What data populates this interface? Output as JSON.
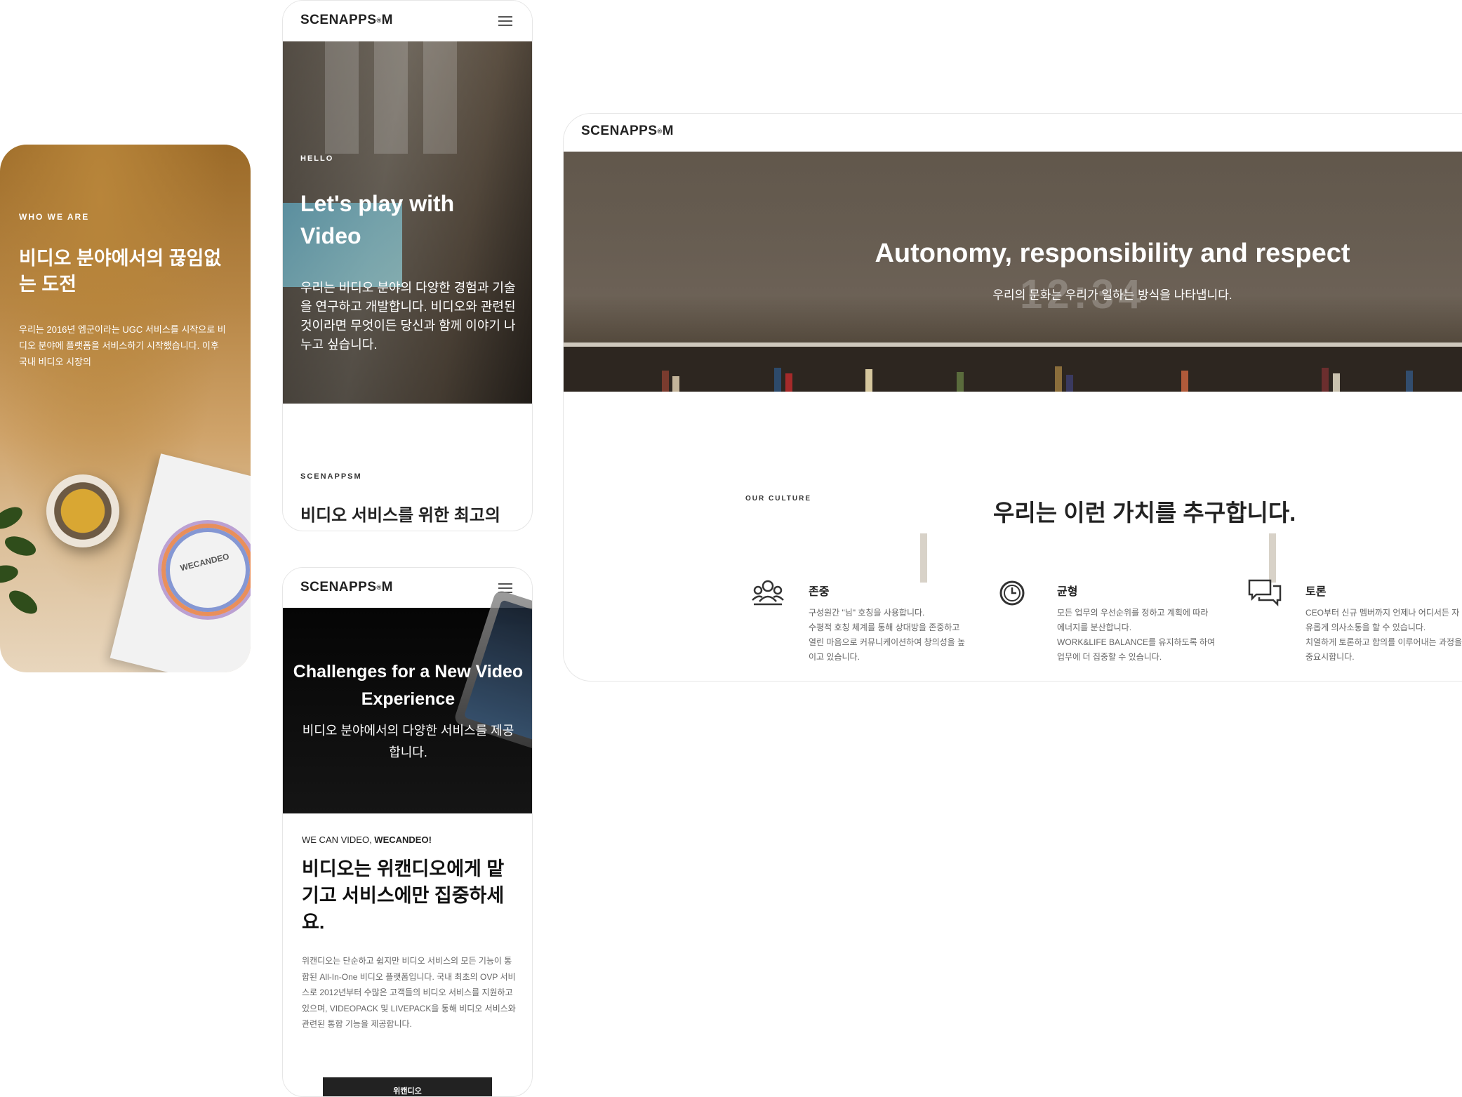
{
  "who_card": {
    "eyebrow": "WHO WE ARE",
    "title": "비디오 분야에서의 끊임없는 도전",
    "body": "우리는 2016년 엠군이라는 UGC 서비스를 시작으로 비디오 분야에 플랫폼을 서비스하기 시작했습니다. 이후 국내 비디오 시장의",
    "product_label": "WECANDEO"
  },
  "hello_card": {
    "logo": "SCENAPPS",
    "logo_dot": "®",
    "logo_suffix": "M",
    "eyebrow": "HELLO",
    "title": "Let's play with Video",
    "desc": "우리는 비디오 분야의 다양한 경험과 기술을 연구하고 개발합니다. 비디오와 관련된 것이라면 무엇이든 당신과 함께 이야기 나누고 싶습니다.",
    "section_label": "SCENAPPSM",
    "section_title": "비디오 서비스를 위한 최고의"
  },
  "challenge_card": {
    "logo": "SCENAPPS",
    "logo_dot": "®",
    "logo_suffix": "M",
    "title": "Challenges for a New Video Experience",
    "desc": "비디오 분야에서의 다양한 서비스를 제공합니다.",
    "kicker_plain": "WE CAN VIDEO, ",
    "kicker_bold": "WECANDEO!",
    "headline": "비디오는 위캔디오에게 맡기고 서비스에만 집중하세요.",
    "body": "위캔디오는 단순하고 쉽지만 비디오 서비스의 모든 기능이 통합된 All-In-One 비디오 플랫폼입니다. 국내 최초의 OVP 서비스로 2012년부터 수많은 고객들의 비디오 서비스를 지원하고 있으며, VIDEOPACK 및 LIVEPACK을 통해 비디오 서비스와 관련된 통합 기능을 제공합니다.",
    "cta": "위캔디오"
  },
  "culture_page": {
    "logo": "SCENAPPS",
    "logo_dot": "®",
    "logo_suffix": "M",
    "hero_title": "Autonomy, responsibility and respect",
    "hero_subtitle": "우리의 문화는 우리가 일하는 방식을 나타냅니다.",
    "clock_text": "12:34",
    "section_label": "OUR CULTURE",
    "headline": "우리는 이런 가치를 추구합니다.",
    "values": [
      {
        "icon": "people-icon",
        "title": "존중",
        "text": "구성원간 \"님\" 호칭을 사용합니다.\n수평적 호칭 체계를 통해 상대방을 존중하고\n열린 마음으로 커뮤니케이션하여 창의성을 높\n이고 있습니다."
      },
      {
        "icon": "clock-icon",
        "title": "균형",
        "text": "모든 업무의 우선순위를 정하고 계획에 따라\n에너지를 분산합니다.\nWORK&LIFE BALANCE를 유지하도록 하여\n업무에 더 집중할 수 있습니다."
      },
      {
        "icon": "chat-icon",
        "title": "토론",
        "text": "CEO부터 신규 멤버까지 언제나 어디서든 자\n유롭게 의사소통을 할 수 있습니다.\n치열하게 토론하고 합의를 이루어내는 과정을\n중요시합니다."
      }
    ]
  },
  "colors": {
    "dark_text": "#222222",
    "muted_text": "#666666",
    "cta_bg": "#222222"
  }
}
